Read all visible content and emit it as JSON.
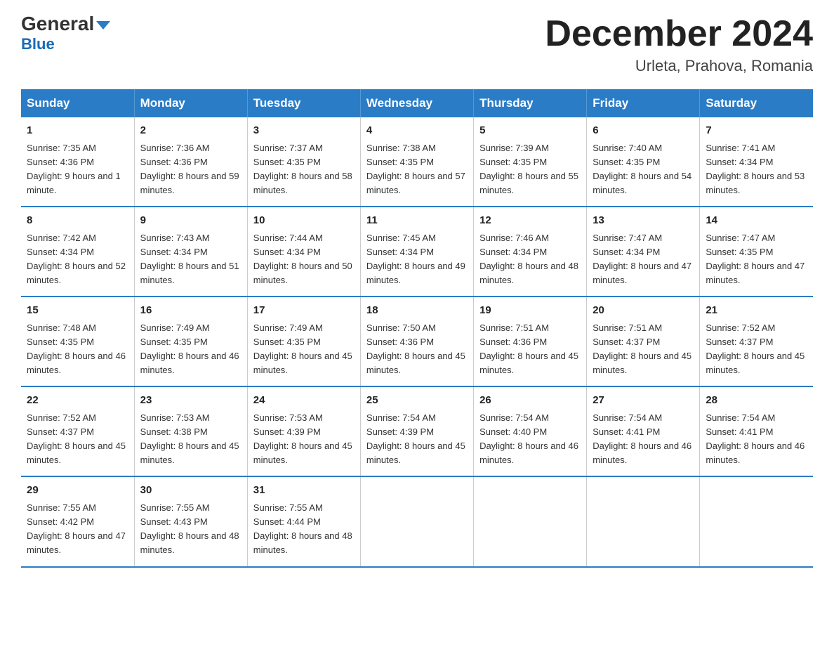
{
  "header": {
    "logo_general": "General",
    "logo_blue": "Blue",
    "month_title": "December 2024",
    "location": "Urleta, Prahova, Romania"
  },
  "days_of_week": [
    "Sunday",
    "Monday",
    "Tuesday",
    "Wednesday",
    "Thursday",
    "Friday",
    "Saturday"
  ],
  "weeks": [
    [
      {
        "day": "1",
        "sunrise": "7:35 AM",
        "sunset": "4:36 PM",
        "daylight": "9 hours and 1 minute."
      },
      {
        "day": "2",
        "sunrise": "7:36 AM",
        "sunset": "4:36 PM",
        "daylight": "8 hours and 59 minutes."
      },
      {
        "day": "3",
        "sunrise": "7:37 AM",
        "sunset": "4:35 PM",
        "daylight": "8 hours and 58 minutes."
      },
      {
        "day": "4",
        "sunrise": "7:38 AM",
        "sunset": "4:35 PM",
        "daylight": "8 hours and 57 minutes."
      },
      {
        "day": "5",
        "sunrise": "7:39 AM",
        "sunset": "4:35 PM",
        "daylight": "8 hours and 55 minutes."
      },
      {
        "day": "6",
        "sunrise": "7:40 AM",
        "sunset": "4:35 PM",
        "daylight": "8 hours and 54 minutes."
      },
      {
        "day": "7",
        "sunrise": "7:41 AM",
        "sunset": "4:34 PM",
        "daylight": "8 hours and 53 minutes."
      }
    ],
    [
      {
        "day": "8",
        "sunrise": "7:42 AM",
        "sunset": "4:34 PM",
        "daylight": "8 hours and 52 minutes."
      },
      {
        "day": "9",
        "sunrise": "7:43 AM",
        "sunset": "4:34 PM",
        "daylight": "8 hours and 51 minutes."
      },
      {
        "day": "10",
        "sunrise": "7:44 AM",
        "sunset": "4:34 PM",
        "daylight": "8 hours and 50 minutes."
      },
      {
        "day": "11",
        "sunrise": "7:45 AM",
        "sunset": "4:34 PM",
        "daylight": "8 hours and 49 minutes."
      },
      {
        "day": "12",
        "sunrise": "7:46 AM",
        "sunset": "4:34 PM",
        "daylight": "8 hours and 48 minutes."
      },
      {
        "day": "13",
        "sunrise": "7:47 AM",
        "sunset": "4:34 PM",
        "daylight": "8 hours and 47 minutes."
      },
      {
        "day": "14",
        "sunrise": "7:47 AM",
        "sunset": "4:35 PM",
        "daylight": "8 hours and 47 minutes."
      }
    ],
    [
      {
        "day": "15",
        "sunrise": "7:48 AM",
        "sunset": "4:35 PM",
        "daylight": "8 hours and 46 minutes."
      },
      {
        "day": "16",
        "sunrise": "7:49 AM",
        "sunset": "4:35 PM",
        "daylight": "8 hours and 46 minutes."
      },
      {
        "day": "17",
        "sunrise": "7:49 AM",
        "sunset": "4:35 PM",
        "daylight": "8 hours and 45 minutes."
      },
      {
        "day": "18",
        "sunrise": "7:50 AM",
        "sunset": "4:36 PM",
        "daylight": "8 hours and 45 minutes."
      },
      {
        "day": "19",
        "sunrise": "7:51 AM",
        "sunset": "4:36 PM",
        "daylight": "8 hours and 45 minutes."
      },
      {
        "day": "20",
        "sunrise": "7:51 AM",
        "sunset": "4:37 PM",
        "daylight": "8 hours and 45 minutes."
      },
      {
        "day": "21",
        "sunrise": "7:52 AM",
        "sunset": "4:37 PM",
        "daylight": "8 hours and 45 minutes."
      }
    ],
    [
      {
        "day": "22",
        "sunrise": "7:52 AM",
        "sunset": "4:37 PM",
        "daylight": "8 hours and 45 minutes."
      },
      {
        "day": "23",
        "sunrise": "7:53 AM",
        "sunset": "4:38 PM",
        "daylight": "8 hours and 45 minutes."
      },
      {
        "day": "24",
        "sunrise": "7:53 AM",
        "sunset": "4:39 PM",
        "daylight": "8 hours and 45 minutes."
      },
      {
        "day": "25",
        "sunrise": "7:54 AM",
        "sunset": "4:39 PM",
        "daylight": "8 hours and 45 minutes."
      },
      {
        "day": "26",
        "sunrise": "7:54 AM",
        "sunset": "4:40 PM",
        "daylight": "8 hours and 46 minutes."
      },
      {
        "day": "27",
        "sunrise": "7:54 AM",
        "sunset": "4:41 PM",
        "daylight": "8 hours and 46 minutes."
      },
      {
        "day": "28",
        "sunrise": "7:54 AM",
        "sunset": "4:41 PM",
        "daylight": "8 hours and 46 minutes."
      }
    ],
    [
      {
        "day": "29",
        "sunrise": "7:55 AM",
        "sunset": "4:42 PM",
        "daylight": "8 hours and 47 minutes."
      },
      {
        "day": "30",
        "sunrise": "7:55 AM",
        "sunset": "4:43 PM",
        "daylight": "8 hours and 48 minutes."
      },
      {
        "day": "31",
        "sunrise": "7:55 AM",
        "sunset": "4:44 PM",
        "daylight": "8 hours and 48 minutes."
      },
      null,
      null,
      null,
      null
    ]
  ]
}
